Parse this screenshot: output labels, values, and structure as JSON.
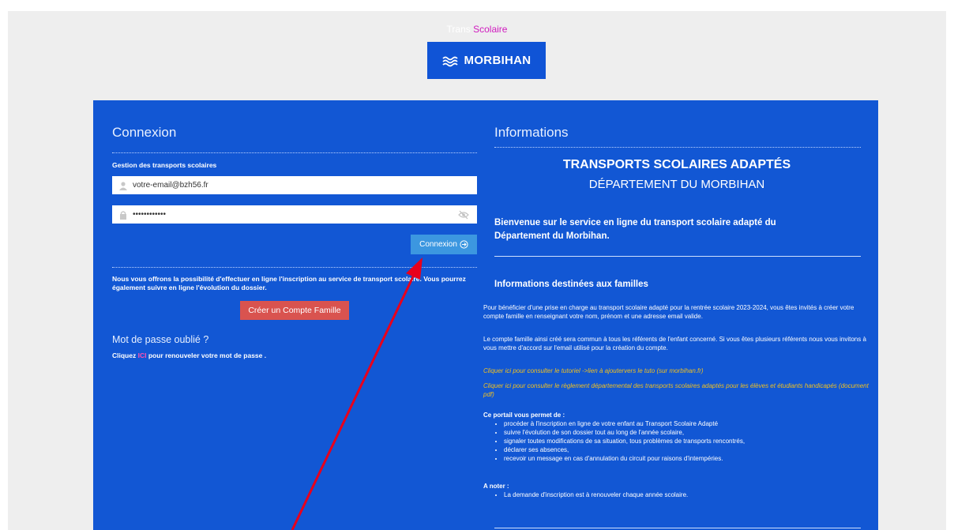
{
  "brand": {
    "part1": "Trans",
    "part2": "Scolaire",
    "logo_text": "MORBIHAN"
  },
  "login": {
    "title": "Connexion",
    "subtitle": "Gestion des transports scolaires",
    "email_value": "votre-email@bzh56.fr",
    "password_value": "••••••••••••",
    "submit_label": "Connexion",
    "intro": "Nous vous offrons la possibilité d'effectuer en ligne l'inscription au service de transport scolaire. Vous pourrez également suivre en ligne l'évolution du dossier.",
    "create_account_label": "Créer un Compte Famille",
    "forgot_title": "Mot de passe oublié ?",
    "forgot_pre": "Cliquez ",
    "forgot_link": "ICI",
    "forgot_post": " pour renouveler votre mot de passe ."
  },
  "info": {
    "title": "Informations",
    "heading1": "TRANSPORTS SCOLAIRES ADAPTÉS",
    "heading2": "DÉPARTEMENT DU MORBIHAN",
    "welcome": "Bienvenue sur le service en ligne du transport scolaire adapté du Département du Morbihan.",
    "families_title": "Informations destinées aux familles",
    "p1": "Pour bénéficier d'une prise en charge au transport scolaire adapté pour la rentrée scolaire 2023-2024, vous êtes invités à créer votre compte famille en renseignant votre nom, prénom et une adresse email valide.",
    "p2": "Le compte famille ainsi créé sera commun à tous les référents de l'enfant concerné. Si vous êtes plusieurs référents nous vous invitons à vous mettre d'accord sur l'email utilisé pour la création du compte.",
    "link1": "Cliquer ici pour consulter le tutoriel ->lien à ajoutervers le tuto (sur morbihan.fr)",
    "link2": "Cliquer ici pour consulter le règlement départemental des transports scolaires adaptés pour les élèves et étudiants handicapés (document pdf)",
    "portal_title": "Ce portail vous permet de :",
    "portal_items": [
      "procéder à l'inscription en ligne de votre enfant au Transport Scolaire Adapté",
      "suivre l'évolution de son dossier tout au long de l'année scolaire,",
      "signaler toutes modifications de sa situation, tous problèmes de transports rencontrés,",
      "déclarer ses absences,",
      "recevoir un message en cas d'annulation du circuit pour raisons d'intempéries."
    ],
    "note_title": "A noter :",
    "note_items": [
      "La demande d'inscription est à renouveler chaque année scolaire."
    ]
  },
  "colors": {
    "panel": "#1257d4",
    "accent_pink": "#d01bbf",
    "create_button": "#d9534f",
    "connect_button": "#3c97e0",
    "annotation_arrow": "#e8001c"
  }
}
